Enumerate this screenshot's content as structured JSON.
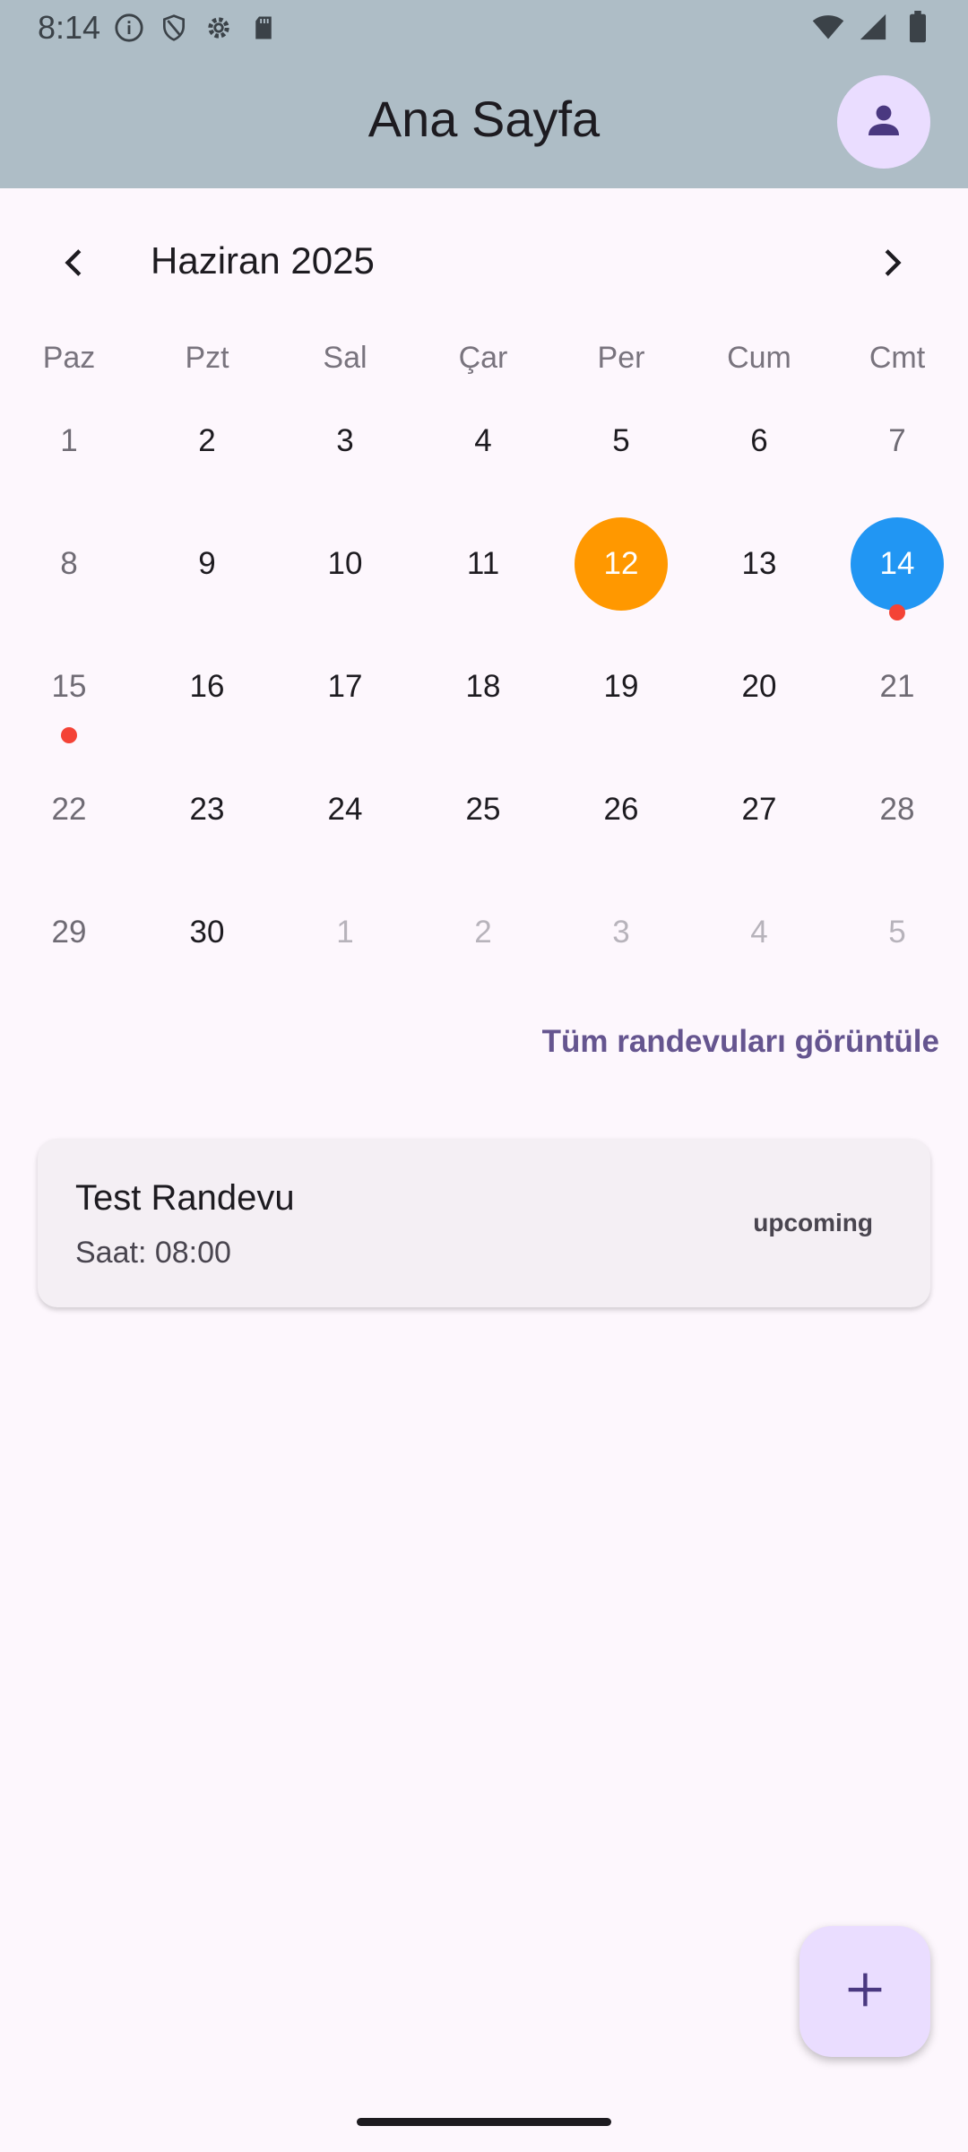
{
  "status_bar": {
    "time": "8:14",
    "icons": [
      "info-icon",
      "shield-icon",
      "gear-icon",
      "sd-card-icon",
      "wifi-icon",
      "signal-icon",
      "battery-icon"
    ]
  },
  "app_bar": {
    "title": "Ana Sayfa",
    "profile_icon": "person-icon"
  },
  "calendar": {
    "month_label": "Haziran 2025",
    "prev_icon": "chevron-left-icon",
    "next_icon": "chevron-right-icon",
    "weekdays": [
      "Paz",
      "Pzt",
      "Sal",
      "Çar",
      "Per",
      "Cum",
      "Cmt"
    ],
    "today": "12",
    "selected": "14",
    "days": [
      {
        "label": "1",
        "state": "current",
        "weekend": true
      },
      {
        "label": "2",
        "state": "current"
      },
      {
        "label": "3",
        "state": "current"
      },
      {
        "label": "4",
        "state": "current"
      },
      {
        "label": "5",
        "state": "current"
      },
      {
        "label": "6",
        "state": "current"
      },
      {
        "label": "7",
        "state": "current",
        "weekend": true
      },
      {
        "label": "8",
        "state": "current",
        "weekend": true
      },
      {
        "label": "9",
        "state": "current"
      },
      {
        "label": "10",
        "state": "current"
      },
      {
        "label": "11",
        "state": "current"
      },
      {
        "label": "12",
        "state": "today"
      },
      {
        "label": "13",
        "state": "current"
      },
      {
        "label": "14",
        "state": "selected",
        "weekend": true,
        "event": true
      },
      {
        "label": "15",
        "state": "current",
        "weekend": true,
        "event": true
      },
      {
        "label": "16",
        "state": "current"
      },
      {
        "label": "17",
        "state": "current"
      },
      {
        "label": "18",
        "state": "current"
      },
      {
        "label": "19",
        "state": "current"
      },
      {
        "label": "20",
        "state": "current"
      },
      {
        "label": "21",
        "state": "current",
        "weekend": true
      },
      {
        "label": "22",
        "state": "current",
        "weekend": true
      },
      {
        "label": "23",
        "state": "current"
      },
      {
        "label": "24",
        "state": "current"
      },
      {
        "label": "25",
        "state": "current"
      },
      {
        "label": "26",
        "state": "current"
      },
      {
        "label": "27",
        "state": "current"
      },
      {
        "label": "28",
        "state": "current",
        "weekend": true
      },
      {
        "label": "29",
        "state": "current",
        "weekend": true
      },
      {
        "label": "30",
        "state": "current"
      },
      {
        "label": "1",
        "state": "other"
      },
      {
        "label": "2",
        "state": "other"
      },
      {
        "label": "3",
        "state": "other"
      },
      {
        "label": "4",
        "state": "other"
      },
      {
        "label": "5",
        "state": "other"
      }
    ],
    "colors": {
      "today": "#ff9800",
      "selected": "#2196f3",
      "event_dot": "#f44336"
    }
  },
  "view_all_label": "Tüm randevuları görüntüle",
  "appointments": [
    {
      "title": "Test Randevu",
      "time": "Saat: 08:00",
      "status": "upcoming"
    }
  ],
  "fab": {
    "icon": "plus-icon"
  },
  "theme": {
    "app_bar_bg": "#aebdc6",
    "background": "#fdf7fd",
    "accent": "#65558f",
    "avatar_bg": "#eaddff"
  }
}
